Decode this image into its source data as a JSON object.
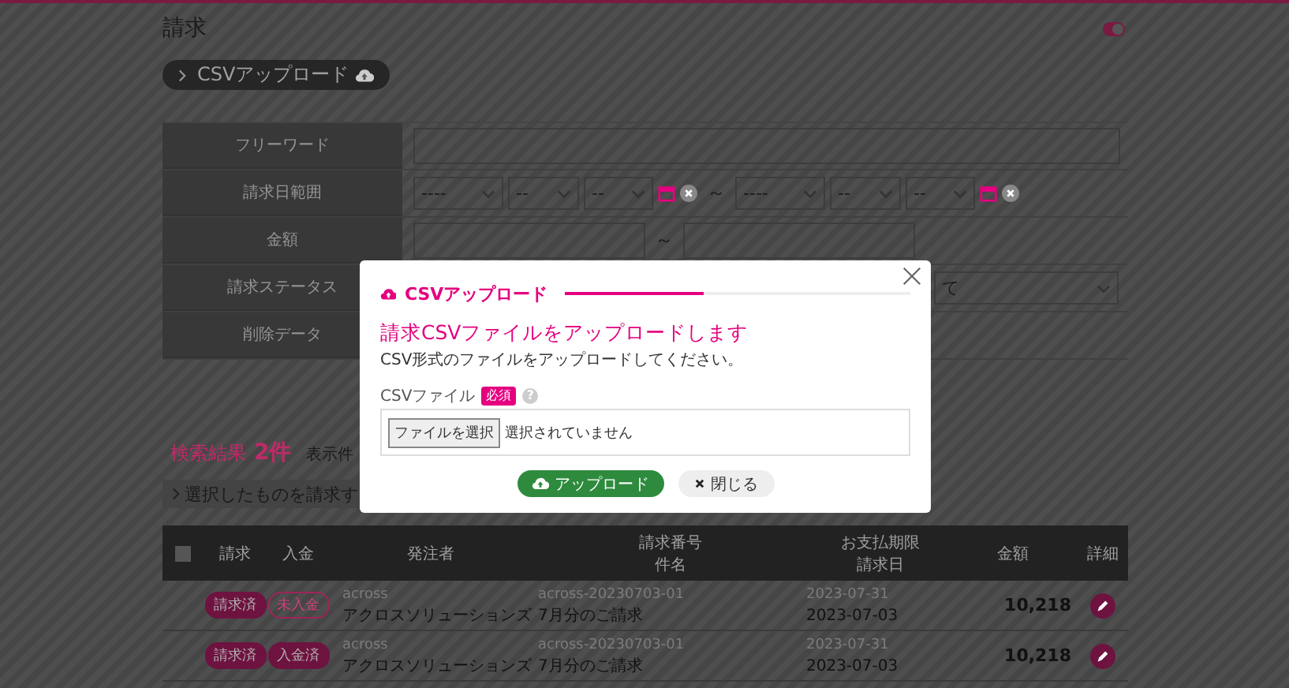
{
  "page": {
    "title": "請求",
    "toggle": {
      "on": true
    },
    "csv_button": {
      "label": "CSVアップロード"
    }
  },
  "search_form": {
    "rows": [
      {
        "kind": "text",
        "label": "フリーワード"
      },
      {
        "kind": "date_range",
        "label": "請求日範囲",
        "from": [
          "----",
          "--",
          "--"
        ],
        "to": [
          "----",
          "--",
          "--"
        ],
        "separator": "～"
      },
      {
        "kind": "number_range",
        "label": "金額",
        "separator": "～"
      },
      {
        "kind": "select",
        "label": "請求ステータス",
        "value": "て"
      },
      {
        "kind": "blank",
        "label": "削除データ"
      }
    ]
  },
  "results": {
    "label": "検索結果",
    "count": "2件",
    "per_page_label": "表示件",
    "bulk_action": "選択したものを請求す"
  },
  "table": {
    "select_all": {
      "checked": false
    },
    "columns": [
      [
        "請求"
      ],
      [
        "入金"
      ],
      [
        "発注者"
      ],
      [
        "請求番号",
        "件名"
      ],
      [
        "お支払期限",
        "請求日"
      ],
      [
        "金額"
      ],
      [
        "詳細"
      ]
    ],
    "rows": [
      {
        "billing": "請求済",
        "payment": "未入金",
        "paid": false,
        "client_code": "across",
        "client": "アクロスソリューションズ",
        "number": "across-20230703-01",
        "subject": "7月分のご請求",
        "due": "2023-07-31",
        "date": "2023-07-03",
        "amount": "10,218"
      },
      {
        "billing": "請求済",
        "payment": "入金済",
        "paid": true,
        "client_code": "across",
        "client": "アクロスソリューションズ",
        "number": "across-20230703-01",
        "subject": "7月分のご請求",
        "due": "2023-07-31",
        "date": "2023-07-03",
        "amount": "10,218"
      }
    ]
  },
  "modal": {
    "title": "CSVアップロード",
    "progress": {
      "level": 0.4
    },
    "heading": "請求CSVファイルをアップロードします",
    "description": "CSV形式のファイルをアップロードしてください。",
    "field_label": "CSVファイル",
    "required_badge": "必須",
    "help_mark": "?",
    "file_button": "ファイルを選択",
    "file_status": "選択されていません",
    "upload_button": "アップロード",
    "close_button": "閉じる"
  }
}
